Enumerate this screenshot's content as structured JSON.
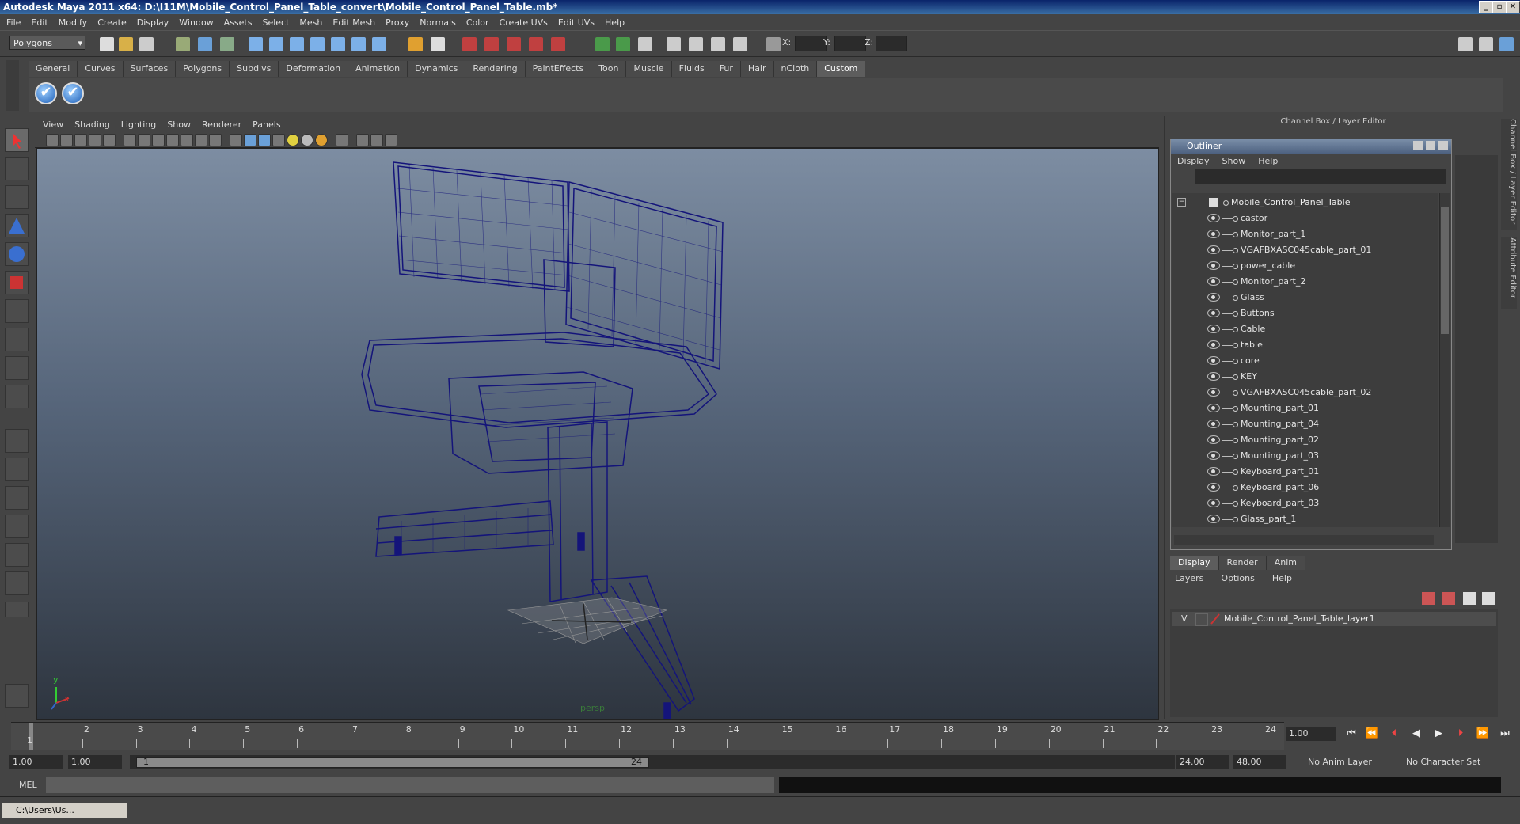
{
  "window": {
    "title": "Autodesk Maya 2011 x64: D:\\I11M\\Mobile_Control_Panel_Table_convert\\Mobile_Control_Panel_Table.mb*",
    "minimize": "_",
    "maximize": "▫",
    "close": "✕"
  },
  "menubar": [
    "File",
    "Edit",
    "Modify",
    "Create",
    "Display",
    "Window",
    "Assets",
    "Select",
    "Mesh",
    "Edit Mesh",
    "Proxy",
    "Normals",
    "Color",
    "Create UVs",
    "Edit UVs",
    "Help"
  ],
  "statusline": {
    "mode": "Polygons",
    "x_label": "X:",
    "y_label": "Y:",
    "z_label": "Z:"
  },
  "shelf": {
    "tabs": [
      "General",
      "Curves",
      "Surfaces",
      "Polygons",
      "Subdivs",
      "Deformation",
      "Animation",
      "Dynamics",
      "Rendering",
      "PaintEffects",
      "Toon",
      "Muscle",
      "Fluids",
      "Fur",
      "Hair",
      "nCloth",
      "Custom"
    ],
    "active_tab": "Custom",
    "check_glyph": "✔"
  },
  "viewport": {
    "menu": [
      "View",
      "Shading",
      "Lighting",
      "Show",
      "Renderer",
      "Panels"
    ],
    "camera_label": "persp",
    "axis_x": "x",
    "axis_y": "y"
  },
  "channel_box": {
    "header": "Channel Box / Layer Editor",
    "side_tab_1": "Channel Box / Layer Editor",
    "side_tab_2": "Attribute Editor"
  },
  "outliner": {
    "title": "Outliner",
    "menu": [
      "Display",
      "Show",
      "Help"
    ],
    "collapse_glyph": "−",
    "root": "Mobile_Control_Panel_Table",
    "items": [
      "castor",
      "Monitor_part_1",
      "VGAFBXASC045cable_part_01",
      "power_cable",
      "Monitor_part_2",
      "Glass",
      "Buttons",
      "Cable",
      "table",
      "core",
      "KEY",
      "VGAFBXASC045cable_part_02",
      "Mounting_part_01",
      "Mounting_part_04",
      "Mounting_part_02",
      "Mounting_part_03",
      "Keyboard_part_01",
      "Keyboard_part_06",
      "Keyboard_part_03",
      "Glass_part_1"
    ]
  },
  "layer_editor": {
    "tabs": [
      "Display",
      "Render",
      "Anim"
    ],
    "active_tab": "Display",
    "menu": [
      "Layers",
      "Options",
      "Help"
    ],
    "layer_visibility": "V",
    "layer_name": "Mobile_Control_Panel_Table_layer1"
  },
  "timeline": {
    "ticks": [
      "1",
      "2",
      "3",
      "4",
      "5",
      "6",
      "7",
      "8",
      "9",
      "10",
      "11",
      "12",
      "13",
      "14",
      "15",
      "16",
      "17",
      "18",
      "19",
      "20",
      "21",
      "22",
      "23",
      "24"
    ],
    "current_frame_marker": "1",
    "current_frame": "1.00",
    "playback_glyphs": [
      "⏮",
      "⏪",
      "⏴",
      "◀",
      "▶",
      "⏵",
      "⏩",
      "⏭"
    ]
  },
  "range": {
    "start_time": "1.00",
    "playback_start": "1.00",
    "slider_start": "1",
    "slider_end": "24",
    "playback_end": "24.00",
    "end_time": "48.00",
    "anim_layer": "No Anim Layer",
    "character_set": "No Character Set"
  },
  "command_line": {
    "label": "MEL"
  },
  "taskbar": {
    "item": "C:\\Users\\Us..."
  },
  "colors": {
    "wireframe": "#14147a",
    "viewport_top": "#7d8da2",
    "viewport_bottom": "#2e353f",
    "ui_bg": "#444444"
  }
}
